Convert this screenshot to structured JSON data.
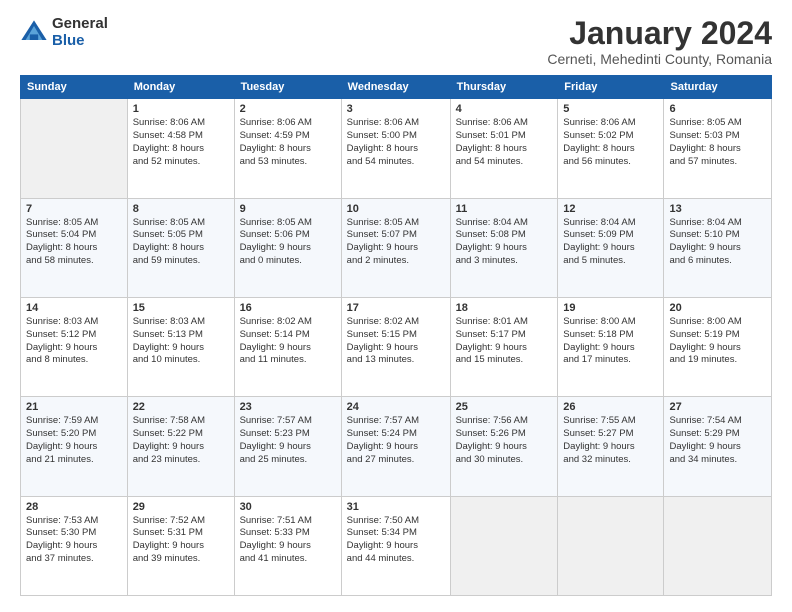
{
  "logo": {
    "general": "General",
    "blue": "Blue"
  },
  "title": "January 2024",
  "location": "Cerneti, Mehedinti County, Romania",
  "days_header": [
    "Sunday",
    "Monday",
    "Tuesday",
    "Wednesday",
    "Thursday",
    "Friday",
    "Saturday"
  ],
  "weeks": [
    [
      {
        "day": "",
        "info": ""
      },
      {
        "day": "1",
        "info": "Sunrise: 8:06 AM\nSunset: 4:58 PM\nDaylight: 8 hours\nand 52 minutes."
      },
      {
        "day": "2",
        "info": "Sunrise: 8:06 AM\nSunset: 4:59 PM\nDaylight: 8 hours\nand 53 minutes."
      },
      {
        "day": "3",
        "info": "Sunrise: 8:06 AM\nSunset: 5:00 PM\nDaylight: 8 hours\nand 54 minutes."
      },
      {
        "day": "4",
        "info": "Sunrise: 8:06 AM\nSunset: 5:01 PM\nDaylight: 8 hours\nand 54 minutes."
      },
      {
        "day": "5",
        "info": "Sunrise: 8:06 AM\nSunset: 5:02 PM\nDaylight: 8 hours\nand 56 minutes."
      },
      {
        "day": "6",
        "info": "Sunrise: 8:05 AM\nSunset: 5:03 PM\nDaylight: 8 hours\nand 57 minutes."
      }
    ],
    [
      {
        "day": "7",
        "info": "Sunrise: 8:05 AM\nSunset: 5:04 PM\nDaylight: 8 hours\nand 58 minutes."
      },
      {
        "day": "8",
        "info": "Sunrise: 8:05 AM\nSunset: 5:05 PM\nDaylight: 8 hours\nand 59 minutes."
      },
      {
        "day": "9",
        "info": "Sunrise: 8:05 AM\nSunset: 5:06 PM\nDaylight: 9 hours\nand 0 minutes."
      },
      {
        "day": "10",
        "info": "Sunrise: 8:05 AM\nSunset: 5:07 PM\nDaylight: 9 hours\nand 2 minutes."
      },
      {
        "day": "11",
        "info": "Sunrise: 8:04 AM\nSunset: 5:08 PM\nDaylight: 9 hours\nand 3 minutes."
      },
      {
        "day": "12",
        "info": "Sunrise: 8:04 AM\nSunset: 5:09 PM\nDaylight: 9 hours\nand 5 minutes."
      },
      {
        "day": "13",
        "info": "Sunrise: 8:04 AM\nSunset: 5:10 PM\nDaylight: 9 hours\nand 6 minutes."
      }
    ],
    [
      {
        "day": "14",
        "info": "Sunrise: 8:03 AM\nSunset: 5:12 PM\nDaylight: 9 hours\nand 8 minutes."
      },
      {
        "day": "15",
        "info": "Sunrise: 8:03 AM\nSunset: 5:13 PM\nDaylight: 9 hours\nand 10 minutes."
      },
      {
        "day": "16",
        "info": "Sunrise: 8:02 AM\nSunset: 5:14 PM\nDaylight: 9 hours\nand 11 minutes."
      },
      {
        "day": "17",
        "info": "Sunrise: 8:02 AM\nSunset: 5:15 PM\nDaylight: 9 hours\nand 13 minutes."
      },
      {
        "day": "18",
        "info": "Sunrise: 8:01 AM\nSunset: 5:17 PM\nDaylight: 9 hours\nand 15 minutes."
      },
      {
        "day": "19",
        "info": "Sunrise: 8:00 AM\nSunset: 5:18 PM\nDaylight: 9 hours\nand 17 minutes."
      },
      {
        "day": "20",
        "info": "Sunrise: 8:00 AM\nSunset: 5:19 PM\nDaylight: 9 hours\nand 19 minutes."
      }
    ],
    [
      {
        "day": "21",
        "info": "Sunrise: 7:59 AM\nSunset: 5:20 PM\nDaylight: 9 hours\nand 21 minutes."
      },
      {
        "day": "22",
        "info": "Sunrise: 7:58 AM\nSunset: 5:22 PM\nDaylight: 9 hours\nand 23 minutes."
      },
      {
        "day": "23",
        "info": "Sunrise: 7:57 AM\nSunset: 5:23 PM\nDaylight: 9 hours\nand 25 minutes."
      },
      {
        "day": "24",
        "info": "Sunrise: 7:57 AM\nSunset: 5:24 PM\nDaylight: 9 hours\nand 27 minutes."
      },
      {
        "day": "25",
        "info": "Sunrise: 7:56 AM\nSunset: 5:26 PM\nDaylight: 9 hours\nand 30 minutes."
      },
      {
        "day": "26",
        "info": "Sunrise: 7:55 AM\nSunset: 5:27 PM\nDaylight: 9 hours\nand 32 minutes."
      },
      {
        "day": "27",
        "info": "Sunrise: 7:54 AM\nSunset: 5:29 PM\nDaylight: 9 hours\nand 34 minutes."
      }
    ],
    [
      {
        "day": "28",
        "info": "Sunrise: 7:53 AM\nSunset: 5:30 PM\nDaylight: 9 hours\nand 37 minutes."
      },
      {
        "day": "29",
        "info": "Sunrise: 7:52 AM\nSunset: 5:31 PM\nDaylight: 9 hours\nand 39 minutes."
      },
      {
        "day": "30",
        "info": "Sunrise: 7:51 AM\nSunset: 5:33 PM\nDaylight: 9 hours\nand 41 minutes."
      },
      {
        "day": "31",
        "info": "Sunrise: 7:50 AM\nSunset: 5:34 PM\nDaylight: 9 hours\nand 44 minutes."
      },
      {
        "day": "",
        "info": ""
      },
      {
        "day": "",
        "info": ""
      },
      {
        "day": "",
        "info": ""
      }
    ]
  ]
}
